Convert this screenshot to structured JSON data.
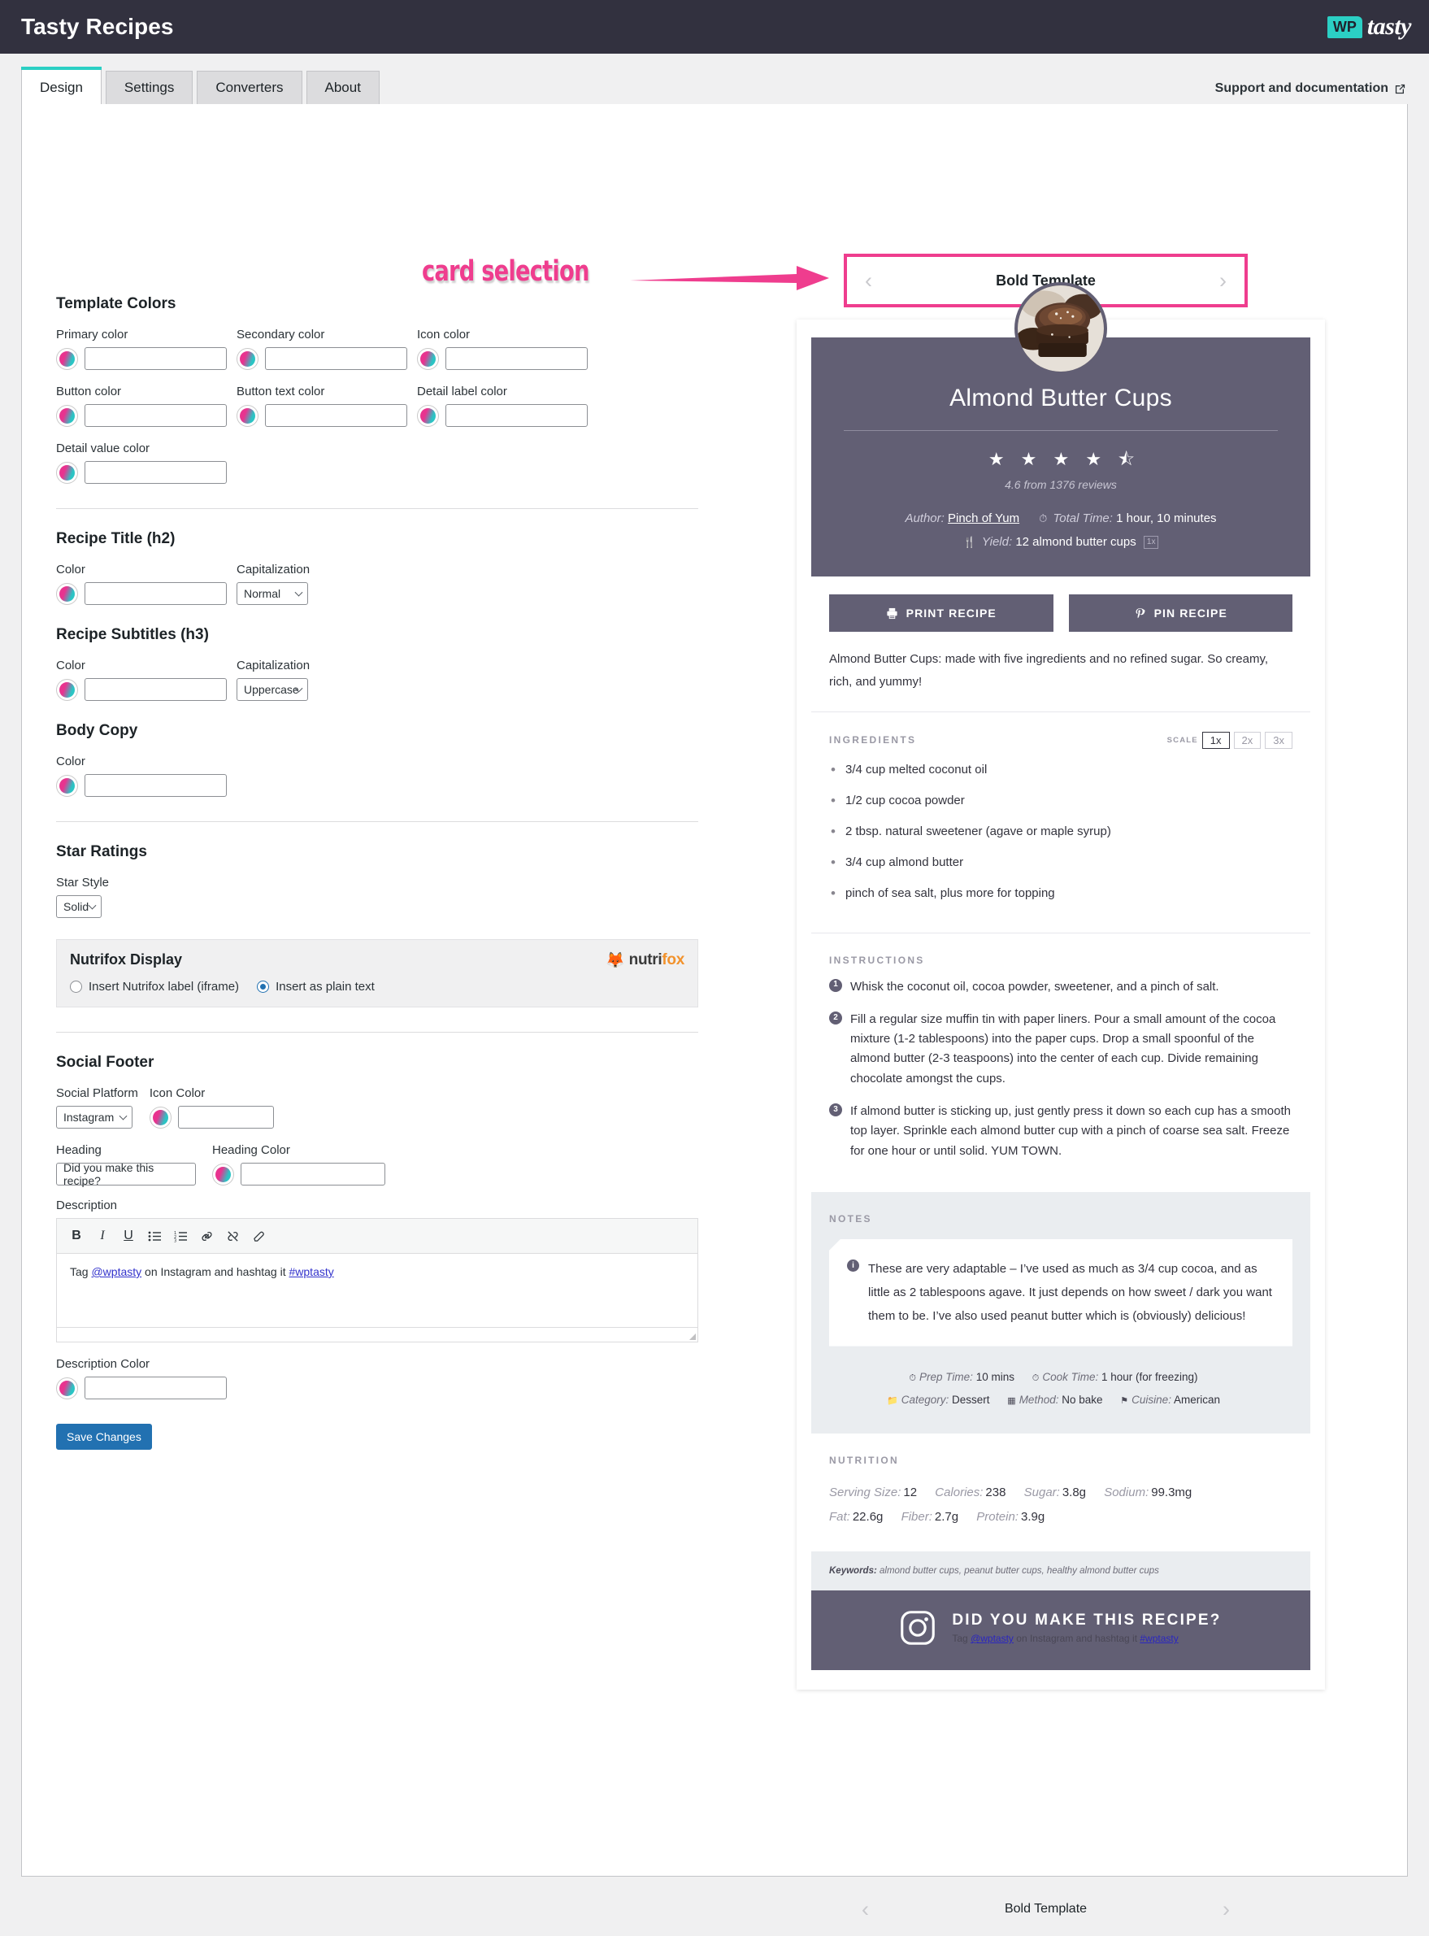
{
  "topbar": {
    "title": "Tasty Recipes",
    "logo_wp": "WP",
    "logo_tasty": "tasty"
  },
  "tabs": [
    {
      "label": "Design",
      "active": true
    },
    {
      "label": "Settings",
      "active": false
    },
    {
      "label": "Converters",
      "active": false
    },
    {
      "label": "About",
      "active": false
    }
  ],
  "support_link": "Support and documentation",
  "annotation": {
    "text": "card selection"
  },
  "form": {
    "template_colors": {
      "title": "Template Colors",
      "fields": [
        {
          "label": "Primary color",
          "value": ""
        },
        {
          "label": "Secondary color",
          "value": ""
        },
        {
          "label": "Icon color",
          "value": ""
        },
        {
          "label": "Button color",
          "value": ""
        },
        {
          "label": "Button text color",
          "value": ""
        },
        {
          "label": "Detail label color",
          "value": ""
        },
        {
          "label": "Detail value color",
          "value": ""
        }
      ]
    },
    "recipe_title": {
      "title": "Recipe Title (h2)",
      "color_label": "Color",
      "cap_label": "Capitalization",
      "cap_value": "Normal"
    },
    "recipe_subtitles": {
      "title": "Recipe Subtitles (h3)",
      "color_label": "Color",
      "cap_label": "Capitalization",
      "cap_value": "Uppercase"
    },
    "body_copy": {
      "title": "Body Copy",
      "color_label": "Color"
    },
    "star_ratings": {
      "title": "Star Ratings",
      "style_label": "Star Style",
      "style_value": "Solid"
    },
    "nutrifox": {
      "title": "Nutrifox Display",
      "option_iframe": "Insert Nutrifox label (iframe)",
      "option_plain": "Insert as plain text",
      "selected": "plain",
      "brand": "nutrifox",
      "brand_prefix": "nutri",
      "brand_suffix": "fox"
    },
    "social_footer": {
      "title": "Social Footer",
      "platform_label": "Social Platform",
      "platform_value": "Instagram",
      "icon_color_label": "Icon Color",
      "heading_label": "Heading",
      "heading_value": "Did you make this recipe?",
      "heading_color_label": "Heading Color",
      "description_label": "Description",
      "description_text_pre": "Tag ",
      "description_handle": "@wptasty",
      "description_text_mid": " on Instagram and hashtag it ",
      "description_hashtag": "#wptasty",
      "description_color_label": "Description Color",
      "toolbar": [
        "B",
        "I",
        "U",
        "bulleted-list",
        "numbered-list",
        "link",
        "unlink",
        "clear-formatting"
      ]
    },
    "save_button": "Save Changes"
  },
  "selector": {
    "template_name": "Bold Template",
    "prev": "‹",
    "next": "›"
  },
  "card": {
    "title": "Almond Butter Cups",
    "rating_value": "4.6",
    "reviews_text": "4.6 from 1376 reviews",
    "stars_full": 4,
    "stars_half": true,
    "author_label": "Author:",
    "author_value": "Pinch of Yum",
    "total_time_label": "Total Time:",
    "total_time_value": "1 hour, 10 minutes",
    "yield_label": "Yield:",
    "yield_value": "12 almond butter cups",
    "yield_scale": "1x",
    "print_button": "PRINT RECIPE",
    "pin_button": "PIN RECIPE",
    "description": "Almond Butter Cups: made with five ingredients and no refined sugar. So creamy, rich, and yummy!",
    "ingredients_heading": "INGREDIENTS",
    "scale_label": "SCALE",
    "scale_options": [
      "1x",
      "2x",
      "3x"
    ],
    "scale_selected": "1x",
    "ingredients": [
      "3/4 cup melted coconut oil",
      "1/2 cup cocoa powder",
      "2 tbsp. natural sweetener (agave or maple syrup)",
      "3/4 cup almond butter",
      "pinch of sea salt, plus more for topping"
    ],
    "instructions_heading": "INSTRUCTIONS",
    "instructions": [
      "Whisk the coconut oil, cocoa powder, sweetener, and a pinch of salt.",
      "Fill a regular size muffin tin with paper liners. Pour a small amount of the cocoa mixture (1-2 tablespoons) into the paper cups. Drop a small spoonful of the almond butter (2-3 teaspoons) into the center of each cup. Divide remaining chocolate amongst the cups.",
      "If almond butter is sticking up, just gently press it down so each cup has a smooth top layer. Sprinkle each almond butter cup with a pinch of coarse sea salt. Freeze for one hour or until solid. YUM TOWN."
    ],
    "notes_heading": "NOTES",
    "notes_text": "These are very adaptable – I’ve used as much as 3/4 cup cocoa, and as little as 2 tablespoons agave. It just depends on how sweet / dark you want them to be. I’ve also used peanut butter which is (obviously) delicious!",
    "details": {
      "prep_time_label": "Prep Time:",
      "prep_time_value": "10 mins",
      "cook_time_label": "Cook Time:",
      "cook_time_value": "1 hour (for freezing)",
      "category_label": "Category:",
      "category_value": "Dessert",
      "method_label": "Method:",
      "method_value": "No bake",
      "cuisine_label": "Cuisine:",
      "cuisine_value": "American"
    },
    "nutrition_heading": "NUTRITION",
    "nutrition": [
      {
        "label": "Serving Size:",
        "value": "12"
      },
      {
        "label": "Calories:",
        "value": "238"
      },
      {
        "label": "Sugar:",
        "value": "3.8g"
      },
      {
        "label": "Sodium:",
        "value": "99.3mg"
      },
      {
        "label": "Fat:",
        "value": "22.6g"
      },
      {
        "label": "Fiber:",
        "value": "2.7g"
      },
      {
        "label": "Protein:",
        "value": "3.9g"
      }
    ],
    "keywords_label": "Keywords:",
    "keywords_value": "almond butter cups, peanut butter cups, healthy almond butter cups",
    "social_heading": "DID YOU MAKE THIS RECIPE?",
    "social_pre": "Tag ",
    "social_handle": "@wptasty",
    "social_mid": " on Instagram and hashtag it ",
    "social_hashtag": "#wptasty"
  },
  "colors": {
    "topbar_bg": "#32313f",
    "accent_teal": "#2bcfc4",
    "annotation_pink": "#ef3d8e",
    "card_dark": "#625f74",
    "card_grey": "#eaedf0",
    "save_blue": "#2271b1"
  }
}
